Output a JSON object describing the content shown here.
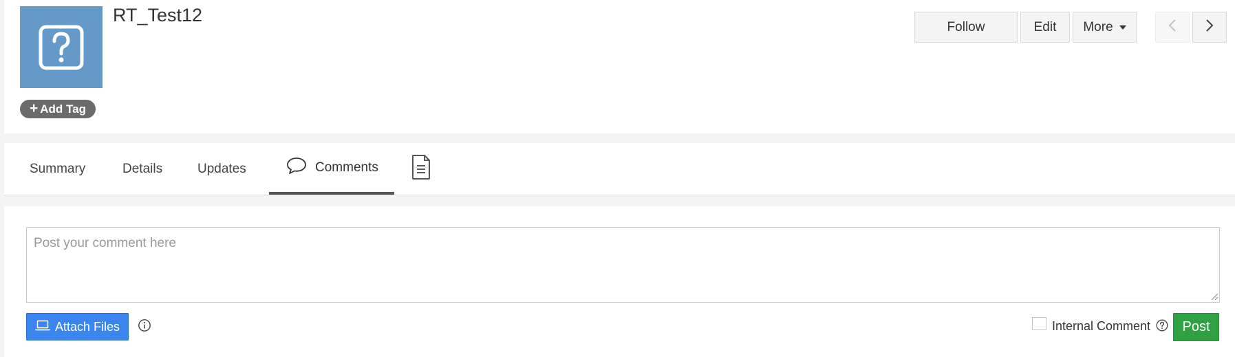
{
  "record": {
    "title": "RT_Test12",
    "avatar_icon": "question-mark-icon",
    "add_tag_label": "Add Tag"
  },
  "toolbar": {
    "follow_label": "Follow",
    "edit_label": "Edit",
    "more_label": "More",
    "prev_icon": "chevron-left-icon",
    "next_icon": "chevron-right-icon"
  },
  "tabs": [
    {
      "label": "Summary"
    },
    {
      "label": "Details"
    },
    {
      "label": "Updates"
    },
    {
      "label": "Comments",
      "active": true,
      "icon": "speech-bubble-icon"
    },
    {
      "label": "",
      "icon": "document-icon"
    }
  ],
  "comment": {
    "placeholder": "Post your comment here",
    "value": "",
    "attach_label": "Attach Files",
    "internal_label": "Internal Comment",
    "internal_checked": false,
    "post_label": "Post"
  },
  "colors": {
    "avatar_bg": "#6499c8",
    "attach_bg": "#3b86ee",
    "post_bg": "#2fa143",
    "tag_bg": "#6b6b6b"
  }
}
